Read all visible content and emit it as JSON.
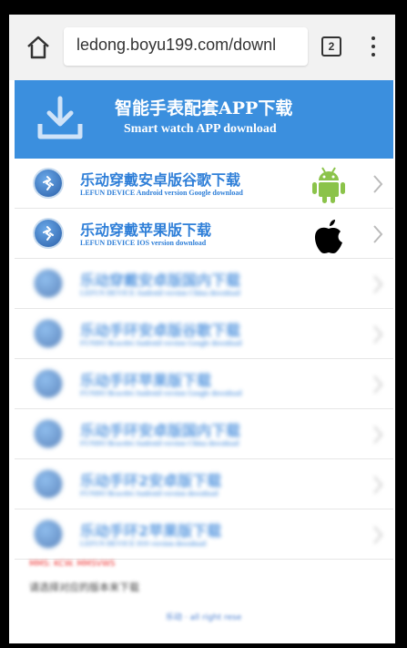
{
  "browser": {
    "url": "ledong.boyu199.com/downl",
    "tab_count": "2"
  },
  "banner": {
    "title": "智能手表配套APP下载",
    "subtitle": "Smart watch APP download"
  },
  "downloads": [
    {
      "title": "乐动穿戴安卓版谷歌下载",
      "subtitle": "LEFUN DEVICE Android version Google download",
      "platform_icon": "android-icon"
    },
    {
      "title": "乐动穿戴苹果版下载",
      "subtitle": "LEFUN DEVICE IOS version download",
      "platform_icon": "apple-icon"
    },
    {
      "title": "乐动穿戴安卓版国内下载",
      "subtitle": "LEFUN DEVICE Android version China download"
    },
    {
      "title": "乐动手环安卓版谷歌下载",
      "subtitle": "FUNDO Bracelet Android version Google download"
    },
    {
      "title": "乐动手环苹果版下载",
      "subtitle": "FUNDO Bracelet Android version Google download"
    },
    {
      "title": "乐动手环安卓版国内下载",
      "subtitle": "FUNDO Bracelet Android version China download"
    },
    {
      "title": "乐动手环2安卓版下载",
      "subtitle": "FUNDO Bracelet Android version download"
    },
    {
      "title": "乐动手环2苹果版下载",
      "subtitle": "LEFUN DEVICE IOS version download"
    }
  ],
  "footer": {
    "notice": "MMS: KCW. MMSVWS",
    "instruction": "请选择对应的版本来下载",
    "link": "乐动 · all right rese"
  },
  "colors": {
    "banner": "#3b8fde",
    "link_blue": "#2f7fd8",
    "android_green": "#8bc34a"
  }
}
